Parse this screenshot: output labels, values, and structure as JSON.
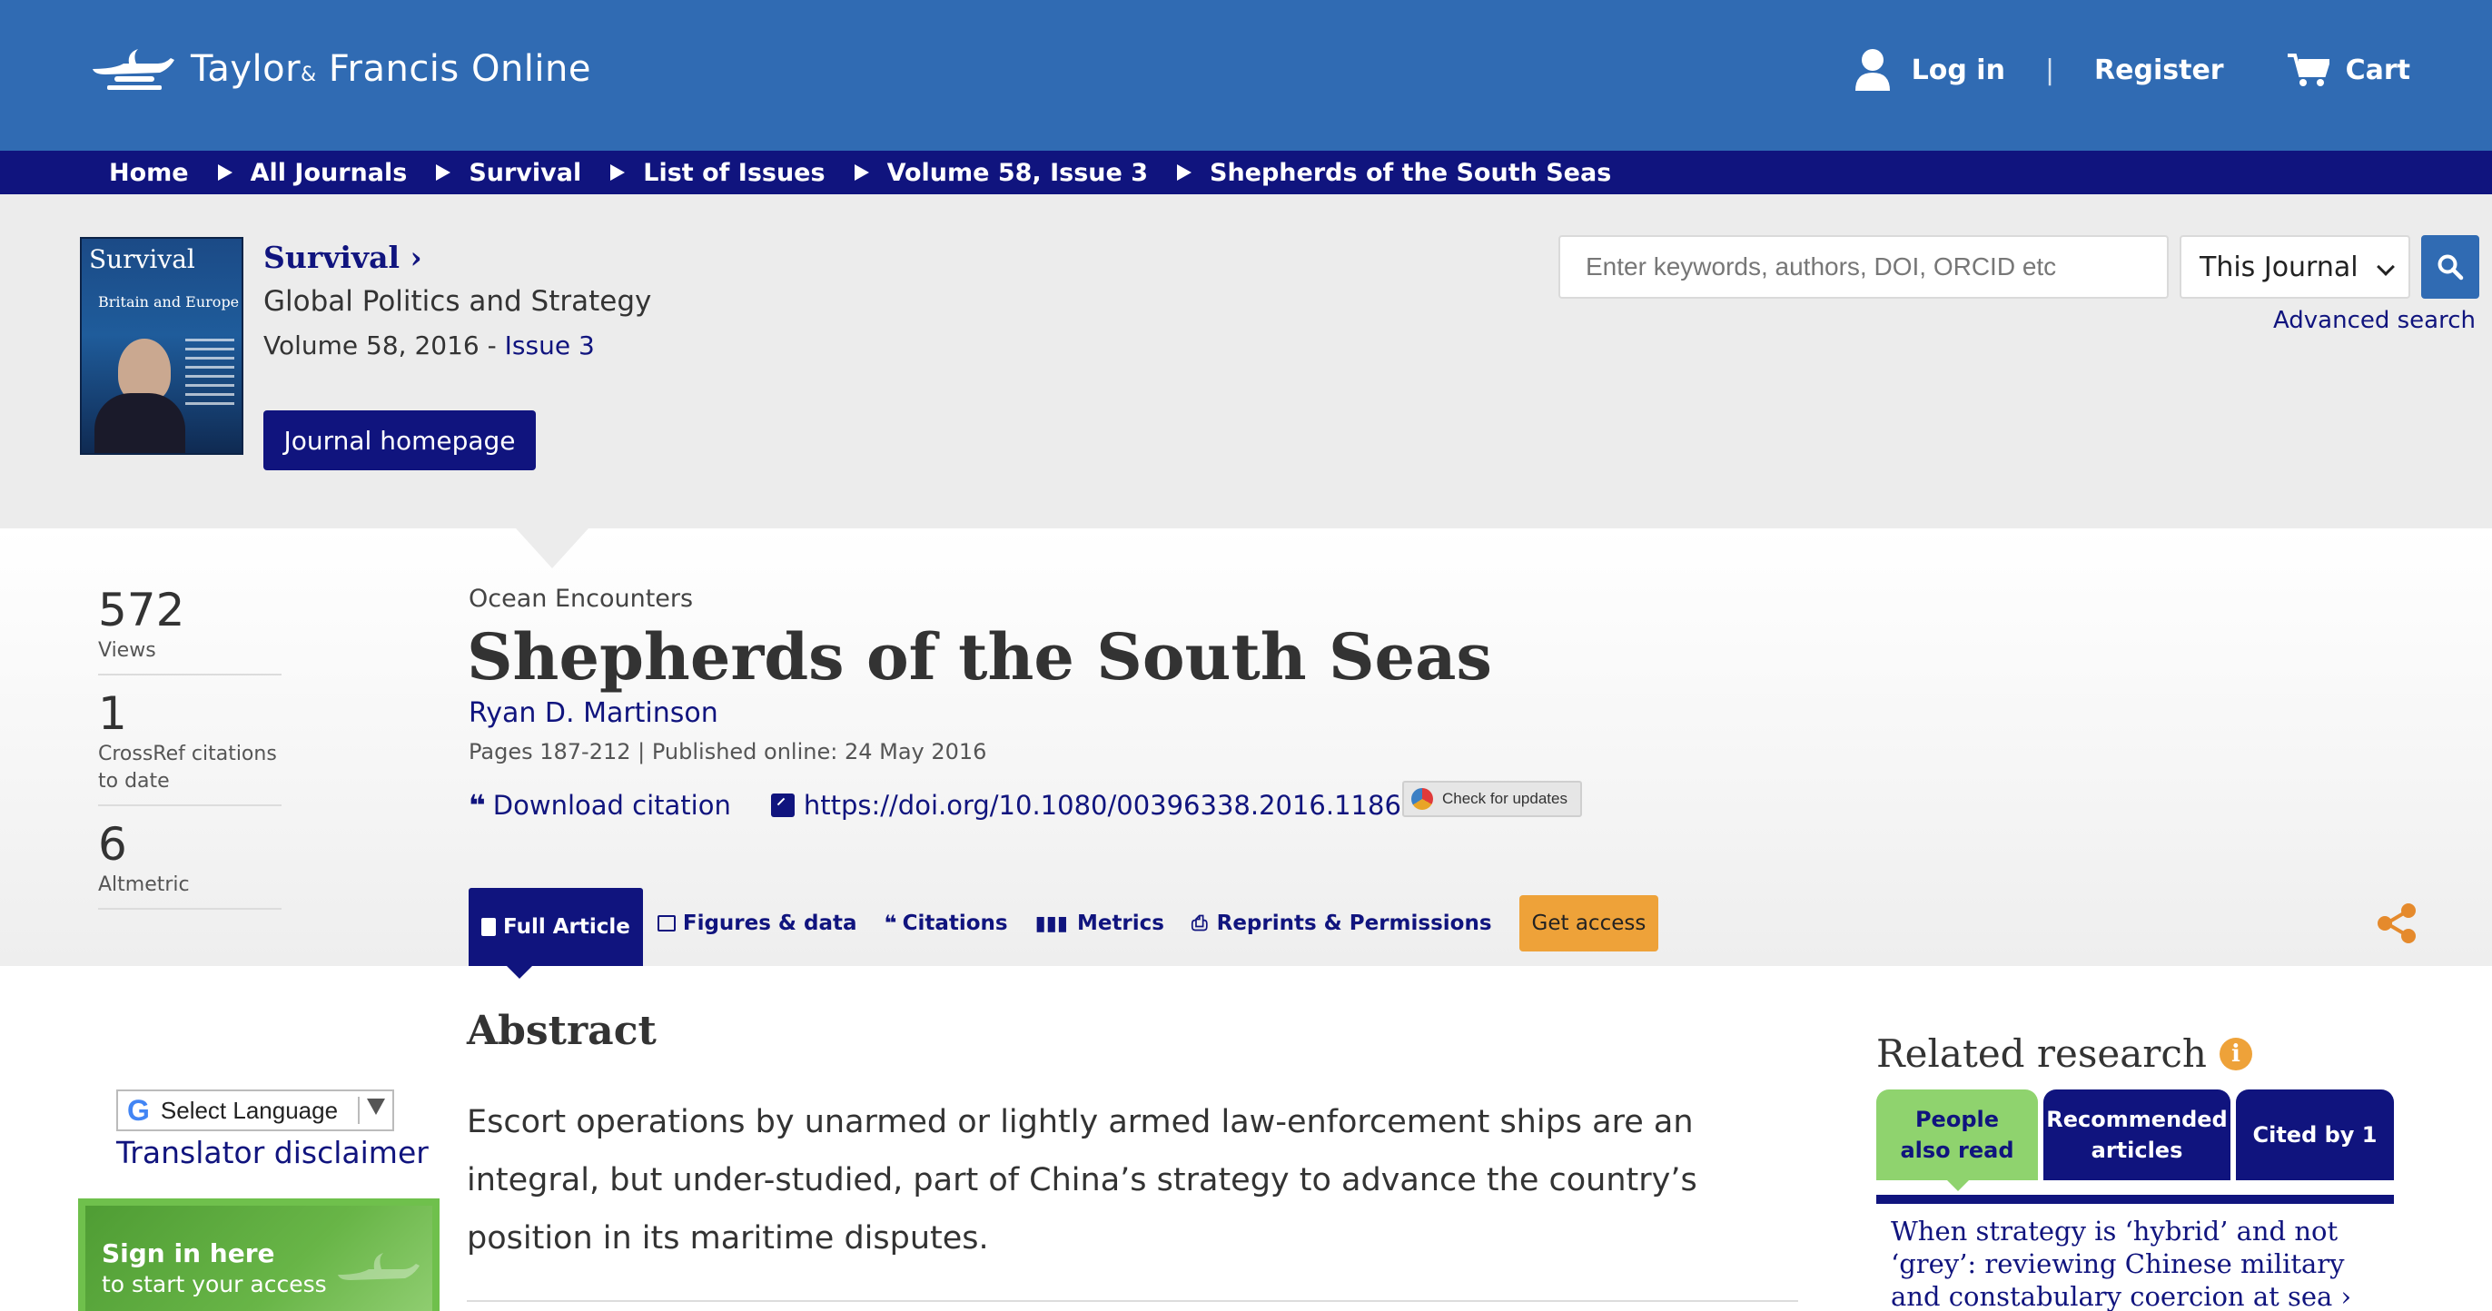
{
  "header": {
    "logo_text": "Taylor",
    "logo_amp": "&",
    "logo_text2": "Francis Online",
    "login": "Log in",
    "separator": "|",
    "register": "Register",
    "cart": "Cart"
  },
  "breadcrumb": [
    "Home",
    "All Journals",
    "Survival",
    "List of Issues",
    "Volume 58, Issue 3",
    "Shepherds of the South Seas"
  ],
  "journal": {
    "cover_title": "Survival",
    "cover_subtitle": "Britain and Europe",
    "title": "Survival",
    "subtitle": "Global Politics and Strategy",
    "volume": "Volume 58, 2016 - ",
    "issue": "Issue 3",
    "homepage_button": "Journal homepage"
  },
  "search": {
    "placeholder": "Enter keywords, authors, DOI, ORCID etc",
    "scope": "This Journal",
    "advanced": "Advanced search"
  },
  "metrics": [
    {
      "value": "572",
      "label": "Views"
    },
    {
      "value": "1",
      "label": "CrossRef citations to date"
    },
    {
      "value": "6",
      "label": "Altmetric"
    }
  ],
  "article": {
    "section": "Ocean Encounters",
    "title": "Shepherds of the South Seas",
    "author": "Ryan D. Martinson",
    "pages": "Pages 187-212 | Published online: 24 May 2016",
    "download_citation": "Download citation",
    "doi": "https://doi.org/10.1080/00396338.2016.1186987",
    "check_updates": "Check for updates"
  },
  "tabs": [
    "Full Article",
    "Figures & data",
    "Citations",
    "Metrics",
    "Reprints & Permissions"
  ],
  "get_access": "Get access",
  "abstract": {
    "heading": "Abstract",
    "text": "Escort operations by unarmed or lightly armed law-enforcement ships are an integral, but under-studied, part of China’s strategy to advance the country’s position in its maritime disputes."
  },
  "sidebar": {
    "select_language": "Select Language",
    "translator_disclaimer": "Translator disclaimer",
    "signin_title": "Sign in here",
    "signin_sub": "to start your access"
  },
  "related": {
    "heading": "Related research",
    "tabs": [
      "People also read",
      "Recommended articles",
      "Cited by 1"
    ],
    "first_item": "When strategy is ‘hybrid’ and not ‘grey’: reviewing Chinese military and constabulary coercion at sea"
  },
  "colors": {
    "header_blue": "#306bb3",
    "navy": "#10147e",
    "accent_orange": "#eea239",
    "green": "#8fd36e"
  }
}
